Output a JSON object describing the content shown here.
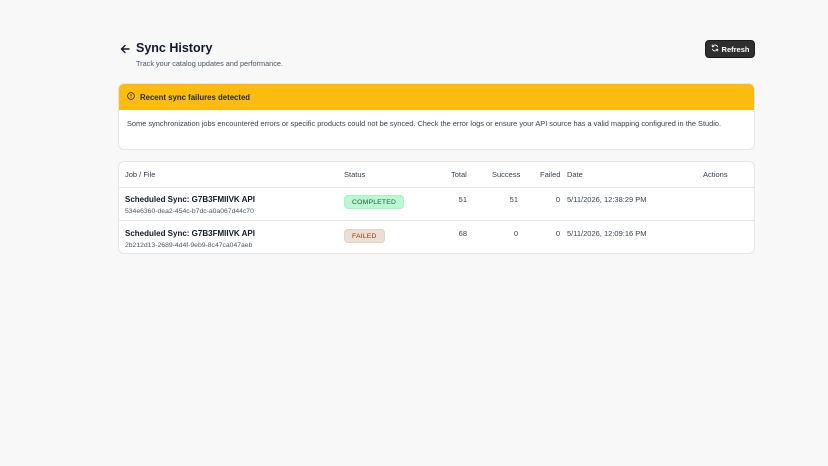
{
  "header": {
    "title": "Sync History",
    "subtitle": "Track your catalog updates and performance.",
    "refresh_label": "Refresh"
  },
  "alert": {
    "title": "Recent sync failures detected",
    "message": "Some synchronization jobs encountered errors or specific products could not be synced. Check the error logs or ensure your API source has a valid mapping configured in the Studio.",
    "color": "#fbbb0f"
  },
  "table": {
    "columns": {
      "job": "Job / File",
      "status": "Status",
      "total": "Total",
      "success": "Success",
      "failed": "Failed",
      "date": "Date",
      "actions": "Actions"
    },
    "rows": [
      {
        "name": "Scheduled Sync: G7B3FMIIVK API",
        "id": "534e6360-dea2-454c-b7dc-a0a067d44c70",
        "status": "COMPLETED",
        "total": "51",
        "success": "51",
        "failed": "0",
        "date": "5/11/2026, 12:38:29 PM"
      },
      {
        "name": "Scheduled Sync: G7B3FMIIVK API",
        "id": "2b212d13-2689-4d4f-9eb9-8c47ca047aeb",
        "status": "FAILED",
        "total": "68",
        "success": "0",
        "failed": "0",
        "date": "5/11/2026, 12:09:16 PM"
      }
    ]
  },
  "icons": {
    "back": "arrow-left-icon",
    "refresh": "refresh-icon",
    "alert": "alert-circle-icon"
  }
}
